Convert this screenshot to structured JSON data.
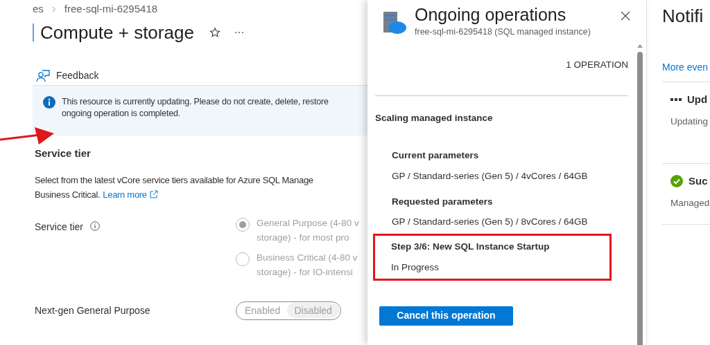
{
  "breadcrumb": [
    "es",
    "free-sql-mi-6295418"
  ],
  "page": {
    "title": "Compute + storage"
  },
  "toolbar": {
    "feedback": "Feedback"
  },
  "banner": {
    "lines": [
      "This resource is currently updating. Please do not create, delete, restore",
      "ongoing operation is completed."
    ]
  },
  "service_tier": {
    "heading": "Service tier",
    "description": [
      "Select from the latest vCore service tiers available for Azure SQL Manage",
      "Business Critical."
    ],
    "link": "Learn more",
    "label": "Service tier",
    "options": [
      {
        "lines": [
          "General Purpose (4-80 v",
          "storage) - for most pro"
        ],
        "selected": true
      },
      {
        "lines": [
          "Business Critical (4-80 v",
          "storage) - for IO-intensi"
        ],
        "selected": false
      }
    ]
  },
  "next_gen": {
    "label": "Next-gen General Purpose",
    "options": [
      {
        "label": "Enabled",
        "selected": false
      },
      {
        "label": "Disabled",
        "selected": true
      }
    ]
  },
  "panel": {
    "title": "Ongoing operations",
    "subtitle": "free-sql-mi-6295418 (SQL managed instance)",
    "count": "1 OPERATION",
    "operation": "Scaling managed instance",
    "sections": [
      {
        "heading": "Current parameters",
        "value": "GP / Standard-series (Gen 5) / 4vCores / 64GB",
        "highlighted": false
      },
      {
        "heading": "Requested parameters",
        "value": "GP / Standard-series (Gen 5) / 8vCores / 64GB",
        "highlighted": false
      },
      {
        "heading": "Step 3/6: New SQL Instance Startup",
        "value": "In Progress",
        "highlighted": true
      }
    ],
    "button": "Cancel this operation"
  },
  "notifications": {
    "title": "Notifi",
    "link": "More even",
    "items": [
      {
        "kind": "progress",
        "title": "Upd",
        "text": "Updating"
      },
      {
        "kind": "success",
        "title": "Suc",
        "text": "Managed"
      }
    ]
  }
}
